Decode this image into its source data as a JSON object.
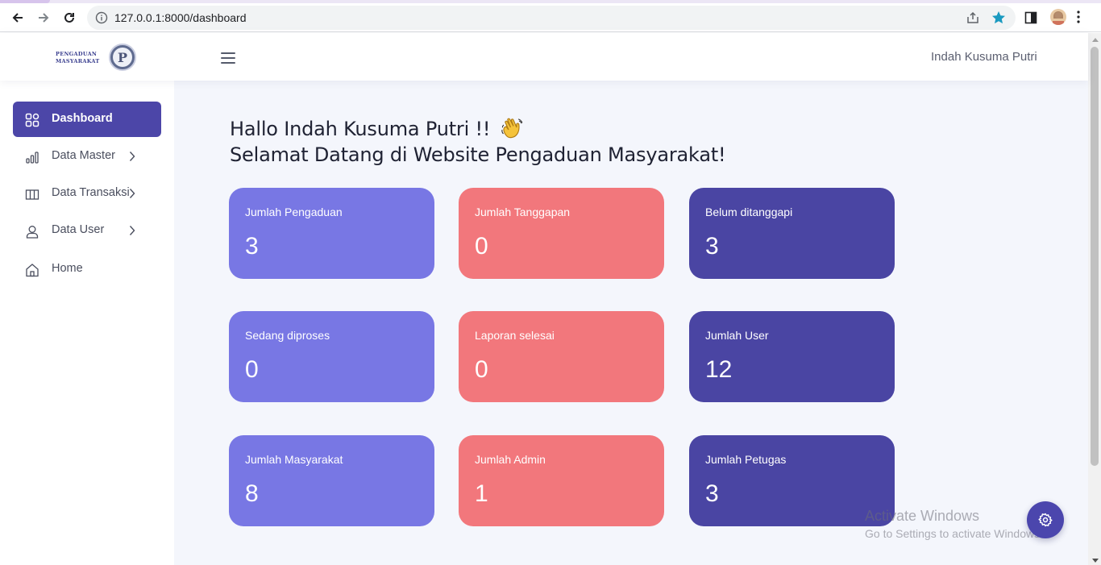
{
  "browser": {
    "url": "127.0.0.1:8000/dashboard"
  },
  "header": {
    "logo_line1": "PENGADUAN",
    "logo_line2": "MASYARAKAT",
    "logo_emblem_letter": "P",
    "user_name": "Indah Kusuma Putri"
  },
  "sidebar": {
    "items": [
      {
        "label": "Dashboard",
        "icon": "grid-icon",
        "active": true
      },
      {
        "label": "Data Master",
        "icon": "bar-chart-icon"
      },
      {
        "label": "Data Transaksi",
        "icon": "columns-icon"
      },
      {
        "label": "Data User",
        "icon": "user-icon"
      },
      {
        "label": "Home",
        "icon": "home-icon"
      }
    ]
  },
  "main": {
    "greeting_line1": "Hallo Indah Kusuma Putri !!",
    "greeting_line2": "Selamat Datang di Website Pengaduan Masyarakat!",
    "cards": [
      {
        "label": "Jumlah Pengaduan",
        "value": "3",
        "color": "#7877e4"
      },
      {
        "label": "Jumlah Tanggapan",
        "value": "0",
        "color": "#f2777c"
      },
      {
        "label": "Belum ditanggapi",
        "value": "3",
        "color": "#4a45a3"
      },
      {
        "label": "Sedang diproses",
        "value": "0",
        "color": "#7877e4"
      },
      {
        "label": "Laporan selesai",
        "value": "0",
        "color": "#f2777c"
      },
      {
        "label": "Jumlah User",
        "value": "12",
        "color": "#4a45a3"
      },
      {
        "label": "Jumlah Masyarakat",
        "value": "8",
        "color": "#7877e4"
      },
      {
        "label": "Jumlah Admin",
        "value": "1",
        "color": "#f2777c"
      },
      {
        "label": "Jumlah Petugas",
        "value": "3",
        "color": "#4a45a3"
      }
    ]
  },
  "watermark": {
    "title": "Activate Windows",
    "subtitle": "Go to Settings to activate Windows."
  },
  "colors": {
    "accent": "#4c46a8",
    "background": "#f4f6fc"
  }
}
